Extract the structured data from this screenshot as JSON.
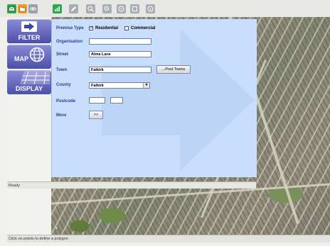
{
  "toolbar": {
    "buttons": [
      {
        "icon": "envelope-icon",
        "color": "#2fa64b"
      },
      {
        "icon": "folder-icon",
        "color": "#f09a2a"
      },
      {
        "icon": "chain-link-icon",
        "color": "#9aa0a8"
      },
      {
        "icon": "chart-icon",
        "color": "#2fa64b"
      },
      {
        "icon": "pencil-icon",
        "color": "#a9adb4"
      },
      {
        "icon": "zoom-in-icon",
        "color": "#a9adb4"
      },
      {
        "icon": "zoom-out-icon",
        "color": "#a9adb4"
      },
      {
        "icon": "pan-icon",
        "color": "#a9adb4"
      },
      {
        "icon": "refresh-icon",
        "color": "#a9adb4"
      },
      {
        "icon": "info-icon",
        "color": "#a9adb4"
      }
    ]
  },
  "nav": {
    "filter": "FILTER",
    "map": "MAP",
    "display": "DISPLAY"
  },
  "form": {
    "premise_type_label": "Premise Type",
    "residential_label": "Residential",
    "commercial_label": "Commercial",
    "organisation_label": "Organisation",
    "organisation_value": "",
    "street_label": "Street",
    "street_value": "Alma Lane",
    "town_label": "Town",
    "town_value": "Falkirk",
    "post_towns_button": "...Post Towns",
    "county_label": "County",
    "county_value": "Falkirk",
    "postcode_label": "Postcode",
    "postcode_part1": "",
    "postcode_part2": "",
    "more_label": "More",
    "more_button": ">>"
  },
  "status": {
    "ready": "Ready",
    "hint": "Click on points to define a polygon"
  },
  "colors": {
    "panel": "#c9defc",
    "nav": "#5b5eb8",
    "label": "#24418a"
  }
}
